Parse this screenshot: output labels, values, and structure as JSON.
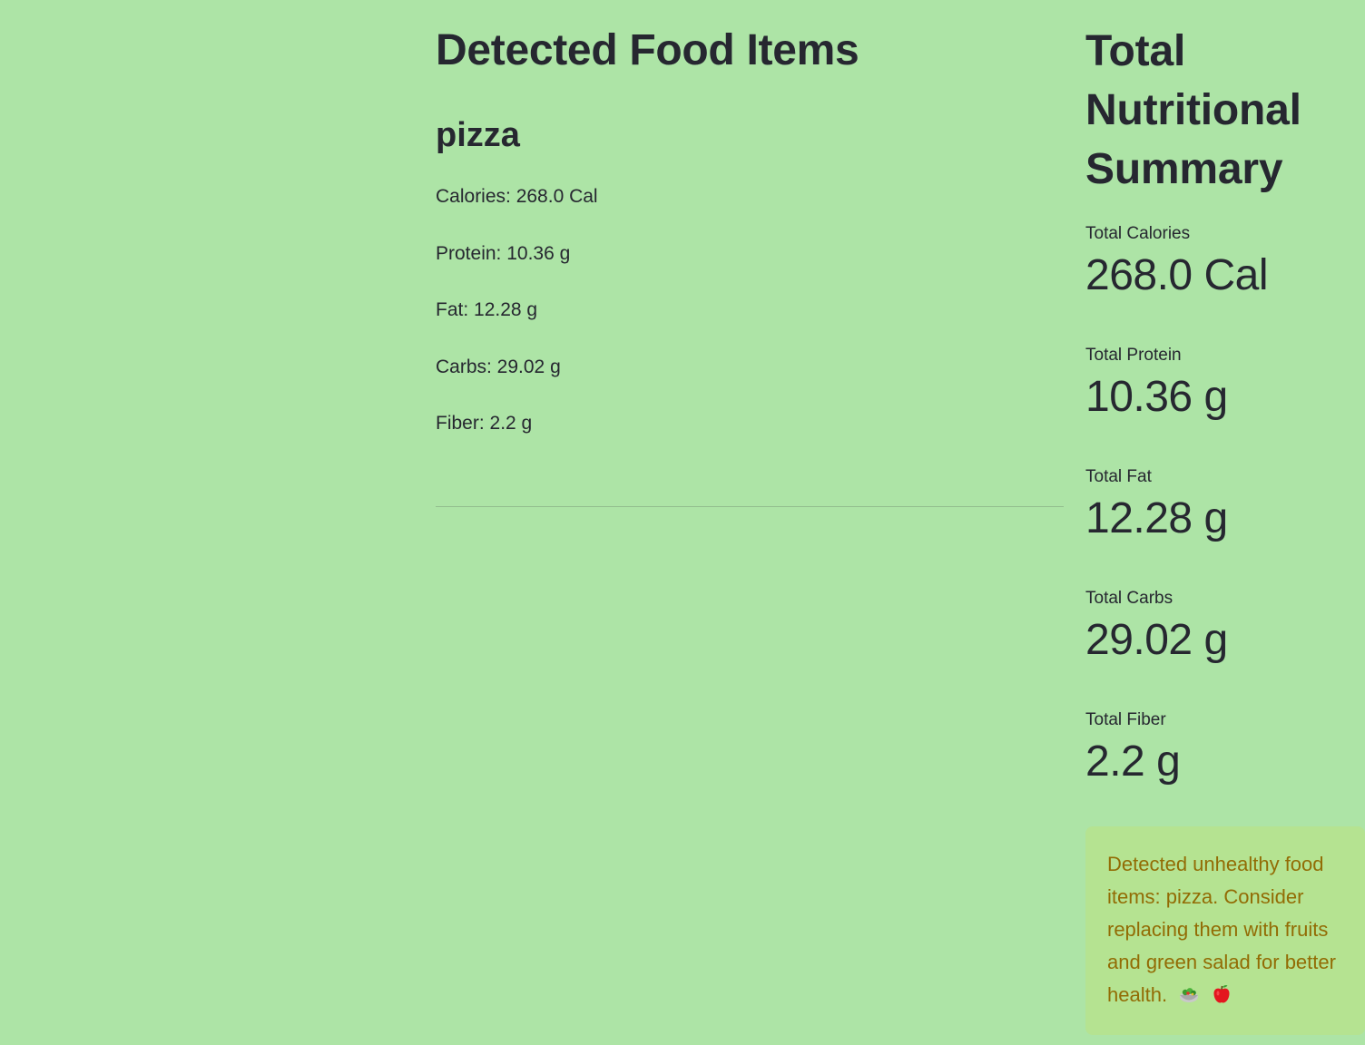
{
  "detected": {
    "heading": "Detected Food Items",
    "food_name": "pizza",
    "nutrients": [
      "Calories: 268.0 Cal",
      "Protein: 10.36 g",
      "Fat: 12.28 g",
      "Carbs: 29.02 g",
      "Fiber: 2.2 g"
    ]
  },
  "summary": {
    "heading": "Total Nutritional Summary",
    "metrics": [
      {
        "label": "Total Calories",
        "value": "268.0 Cal"
      },
      {
        "label": "Total Protein",
        "value": "10.36 g"
      },
      {
        "label": "Total Fat",
        "value": "12.28 g"
      },
      {
        "label": "Total Carbs",
        "value": "29.02 g"
      },
      {
        "label": "Total Fiber",
        "value": "2.2 g"
      }
    ]
  },
  "warning": {
    "text": "Detected unhealthy food items: pizza. Consider replacing them with fruits and green salad for better health.",
    "icons": [
      "salad-icon",
      "apple-icon"
    ]
  },
  "colors": {
    "background": "#ade4a6",
    "warning_background": "#b5e391",
    "warning_text": "#926c05",
    "text": "#262730"
  }
}
